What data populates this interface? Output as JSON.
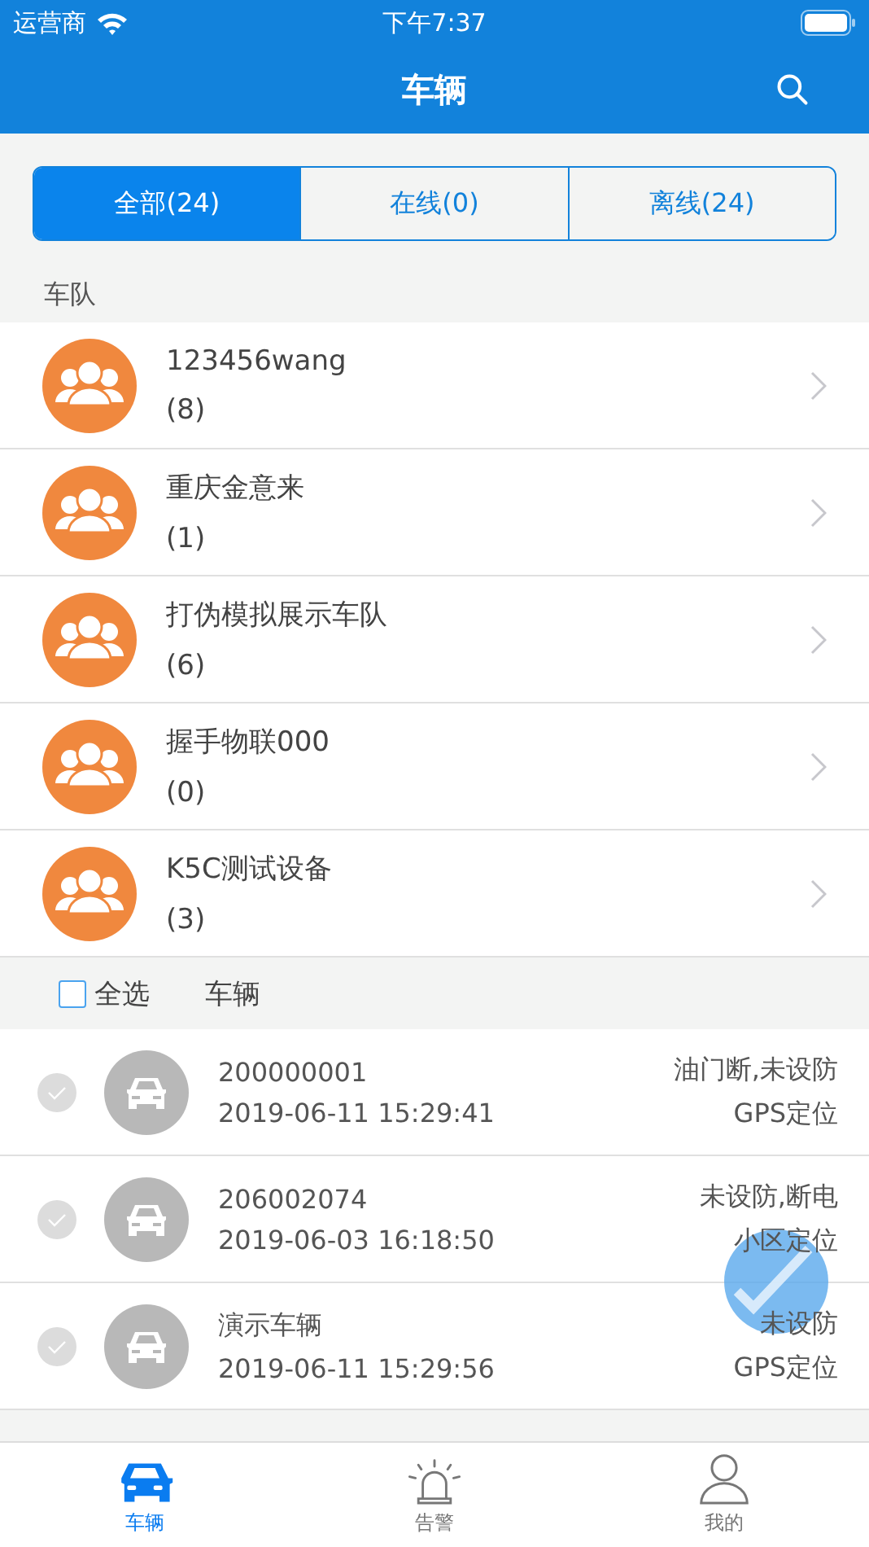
{
  "status_bar": {
    "carrier": "运营商",
    "time": "下午7:37"
  },
  "nav": {
    "title": "车辆"
  },
  "segments": [
    {
      "label": "全部(24)",
      "selected": true
    },
    {
      "label": "在线(0)",
      "selected": false
    },
    {
      "label": "离线(24)",
      "selected": false
    }
  ],
  "fleet_section": {
    "title": "车队"
  },
  "fleets": [
    {
      "name": "123456wang",
      "count": "(8)"
    },
    {
      "name": "重庆金意来",
      "count": "(1)"
    },
    {
      "name": "打伪模拟展示车队",
      "count": "(6)"
    },
    {
      "name": "握手物联000",
      "count": "(0)"
    },
    {
      "name": "K5C测试设备",
      "count": "(3)"
    }
  ],
  "vehicle_header": {
    "select_all": "全选",
    "checked": false,
    "column": "车辆"
  },
  "vehicles": [
    {
      "id": "200000001",
      "time": "2019-06-11 15:29:41",
      "status": "油门断,未设防",
      "location": "GPS定位",
      "selected": false
    },
    {
      "id": "206002074",
      "time": "2019-06-03 16:18:50",
      "status": "未设防,断电",
      "location": "小区定位",
      "selected": false
    },
    {
      "id": "演示车辆",
      "time": "2019-06-11 15:29:56",
      "status": "未设防",
      "location": "GPS定位",
      "selected": false
    }
  ],
  "tabs": [
    {
      "label": "车辆",
      "kind": "car",
      "selected": true
    },
    {
      "label": "告警",
      "kind": "alarm",
      "selected": false
    },
    {
      "label": "我的",
      "kind": "person",
      "selected": false
    }
  ]
}
